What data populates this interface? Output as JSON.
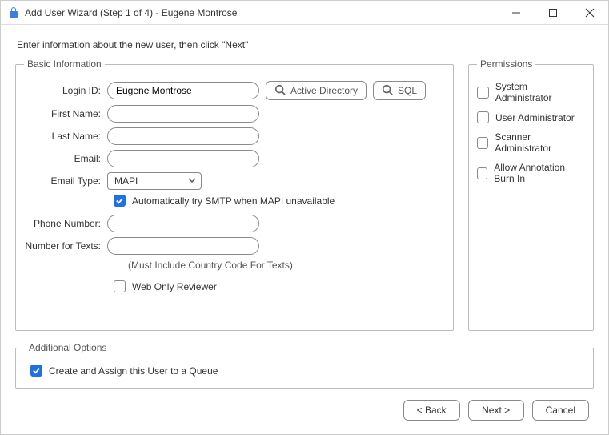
{
  "window": {
    "title": "Add User Wizard (Step 1 of 4) - Eugene Montrose"
  },
  "instruction": "Enter information about the new user, then click \"Next\"",
  "basic": {
    "legend": "Basic Information",
    "labels": {
      "login": "Login ID:",
      "first": "First Name:",
      "last": "Last Name:",
      "email": "Email:",
      "emailType": "Email Type:",
      "phone": "Phone Number:",
      "texts": "Number for Texts:"
    },
    "values": {
      "login": "Eugene Montrose",
      "first": "",
      "last": "",
      "email": "",
      "emailType": "MAPI",
      "phone": "",
      "texts": ""
    },
    "smtpFallback": {
      "checked": true,
      "label": "Automatically try SMTP when MAPI unavailable"
    },
    "textsHint": "(Must Include Country Code For Texts)",
    "webOnly": {
      "checked": false,
      "label": "Web Only Reviewer"
    },
    "buttons": {
      "ad": "Active Directory",
      "sql": "SQL"
    }
  },
  "permissions": {
    "legend": "Permissions",
    "items": [
      {
        "label": "System Administrator",
        "checked": false
      },
      {
        "label": "User Administrator",
        "checked": false
      },
      {
        "label": "Scanner Administrator",
        "checked": false
      },
      {
        "label": "Allow Annotation Burn In",
        "checked": false
      }
    ]
  },
  "additional": {
    "legend": "Additional Options",
    "queue": {
      "checked": true,
      "label": "Create and Assign this User to a Queue"
    }
  },
  "footer": {
    "back": "< Back",
    "next": "Next >",
    "cancel": "Cancel"
  }
}
